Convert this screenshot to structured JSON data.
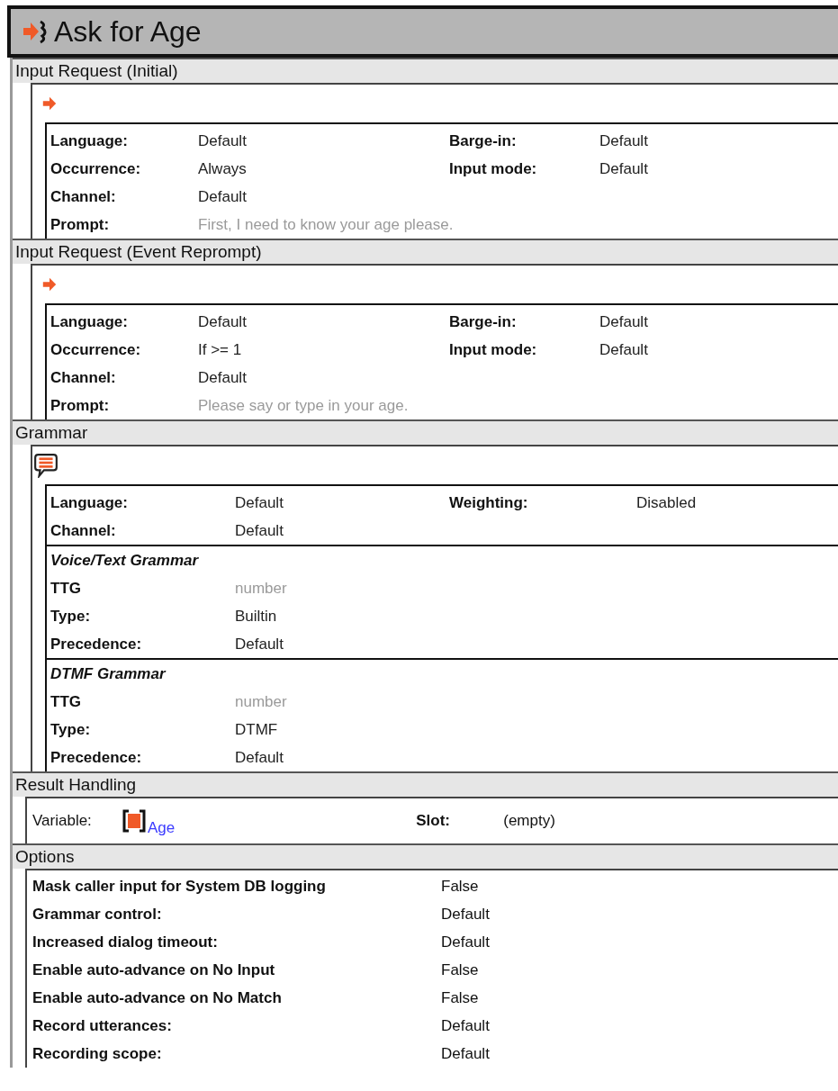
{
  "title": "Ask for Age",
  "sections": [
    {
      "kind": "request",
      "title": "Input Request (Initial)",
      "rows": [
        [
          {
            "label": "Language:",
            "value": "Default",
            "muted": false
          },
          {
            "label": "Barge-in:",
            "value": "Default",
            "muted": false
          }
        ],
        [
          {
            "label": "Occurrence:",
            "value": "Always",
            "muted": false
          },
          {
            "label": "Input mode:",
            "value": "Default",
            "muted": false
          }
        ],
        [
          {
            "label": "Channel:",
            "value": "Default",
            "muted": false
          }
        ],
        [
          {
            "label": "Prompt:",
            "value": "First, I need to know your age please.",
            "muted": true
          }
        ]
      ]
    },
    {
      "kind": "request",
      "title": "Input Request (Event Reprompt)",
      "rows": [
        [
          {
            "label": "Language:",
            "value": "Default",
            "muted": false
          },
          {
            "label": "Barge-in:",
            "value": "Default",
            "muted": false
          }
        ],
        [
          {
            "label": "Occurrence:",
            "value": "If >= 1",
            "muted": false
          },
          {
            "label": "Input mode:",
            "value": "Default",
            "muted": false
          }
        ],
        [
          {
            "label": "Channel:",
            "value": "Default",
            "muted": false
          }
        ],
        [
          {
            "label": "Prompt:",
            "value": "Please say or type in your age.",
            "muted": true
          }
        ]
      ]
    },
    {
      "kind": "grammar",
      "title": "Grammar",
      "rows": [
        [
          {
            "label": "Language:",
            "value": "Default",
            "muted": false
          },
          {
            "label": "Weighting:",
            "value": "Disabled",
            "muted": false
          }
        ],
        [
          {
            "label": "Channel:",
            "value": "Default",
            "muted": false
          }
        ]
      ],
      "groups": [
        {
          "title": "Voice/Text Grammar",
          "rows": [
            {
              "label": "TTG",
              "value": "number",
              "muted": true
            },
            {
              "label": "Type:",
              "value": "Builtin",
              "muted": false
            },
            {
              "label": "Precedence:",
              "value": "Default",
              "muted": false
            }
          ]
        },
        {
          "title": "DTMF Grammar",
          "rows": [
            {
              "label": "TTG",
              "value": "number",
              "muted": true
            },
            {
              "label": "Type:",
              "value": "DTMF",
              "muted": false
            },
            {
              "label": "Precedence:",
              "value": "Default",
              "muted": false
            }
          ]
        }
      ]
    },
    {
      "kind": "result",
      "title": "Result Handling",
      "variable": {
        "label": "Variable:",
        "value": "Age"
      },
      "slot": {
        "label": "Slot:",
        "value": "(empty)"
      }
    },
    {
      "kind": "options",
      "title": "Options",
      "rows": [
        {
          "label": "Mask caller input for System DB logging",
          "value": "False"
        },
        {
          "label": "Grammar control:",
          "value": "Default"
        },
        {
          "label": "Increased dialog timeout:",
          "value": "Default"
        },
        {
          "label": "Enable auto-advance on No Input",
          "value": "False"
        },
        {
          "label": "Enable auto-advance on No Match",
          "value": "False"
        },
        {
          "label": "Record utterances:",
          "value": "Default"
        },
        {
          "label": "Recording scope:",
          "value": "Default"
        }
      ]
    }
  ]
}
